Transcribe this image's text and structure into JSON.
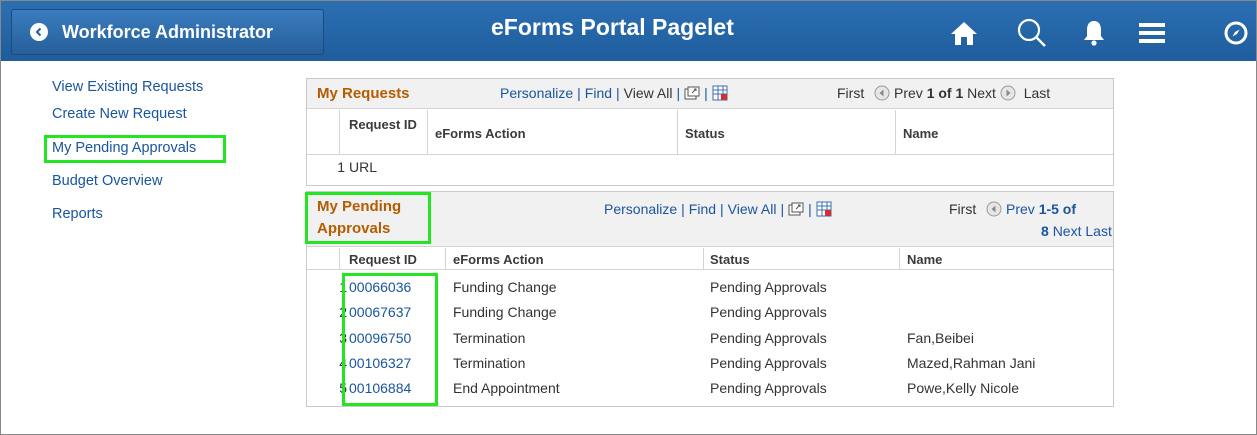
{
  "header": {
    "back_label": "Workforce Administrator",
    "title": "eForms Portal Pagelet",
    "icons": [
      "home-icon",
      "search-icon",
      "bell-icon",
      "menu-icon",
      "navbar-icon"
    ]
  },
  "nav": {
    "items": [
      {
        "label": "View Existing Requests"
      },
      {
        "label": "Create New Request"
      },
      {
        "label": "My Pending Approvals",
        "highlighted": true
      },
      {
        "label": "Budget Overview"
      },
      {
        "label": "Reports"
      }
    ]
  },
  "my_requests": {
    "title": "My Requests",
    "personalize": "Personalize",
    "find": "Find",
    "view_all": "View All",
    "first": "First",
    "prev": "Prev",
    "range": "1 of 1",
    "next": "Next",
    "last": "Last",
    "columns": {
      "id": "Request ID",
      "action": "eForms Action",
      "status": "Status",
      "name": "Name"
    },
    "rows": [
      {
        "num": "1",
        "id": "URL",
        "action": "",
        "status": "",
        "name": ""
      }
    ]
  },
  "pending": {
    "title_line1": "My Pending",
    "title_line2": "Approvals",
    "personalize": "Personalize",
    "find": "Find",
    "view_all": "View All",
    "first": "First",
    "prev": "Prev",
    "range_a": "1-5 of",
    "range_b": "8",
    "next": "Next",
    "last": "Last",
    "columns": {
      "id": "Request ID",
      "action": "eForms Action",
      "status": "Status",
      "name": "Name"
    },
    "rows": [
      {
        "num": "1",
        "id": "00066036",
        "action": "Funding Change",
        "status": "Pending Approvals",
        "name": ""
      },
      {
        "num": "2",
        "id": "00067637",
        "action": "Funding Change",
        "status": "Pending Approvals",
        "name": ""
      },
      {
        "num": "3",
        "id": "00096750",
        "action": "Termination",
        "status": "Pending Approvals",
        "name": "Fan,Beibei"
      },
      {
        "num": "4",
        "id": "00106327",
        "action": "Termination",
        "status": "Pending Approvals",
        "name": "Mazed,Rahman Jani"
      },
      {
        "num": "5",
        "id": "00106884",
        "action": "End Appointment",
        "status": "Pending Approvals",
        "name": "Powe,Kelly Nicole"
      }
    ]
  },
  "colors": {
    "header_bg": "#2466a8",
    "link": "#1a55a0",
    "title_orange": "#b65c00",
    "highlight": "#22e622"
  }
}
